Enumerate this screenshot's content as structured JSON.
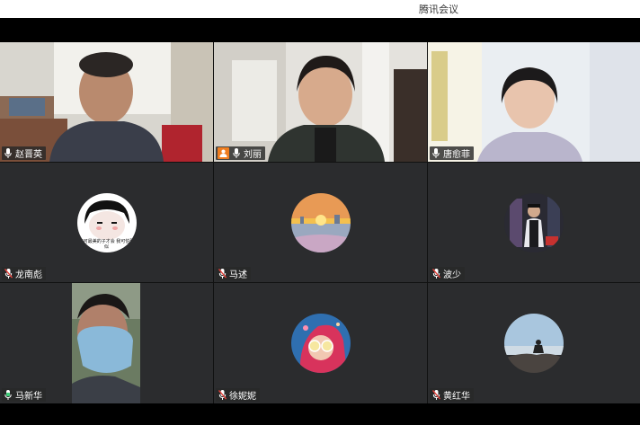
{
  "app": {
    "title": "腾讯会议"
  },
  "participants": [
    {
      "name": "赵晋英",
      "mic": "on",
      "video": true,
      "host": false
    },
    {
      "name": "刘丽",
      "mic": "on",
      "video": true,
      "host": true
    },
    {
      "name": "唐愈菲",
      "mic": "on",
      "video": true,
      "host": false
    },
    {
      "name": "龙南彪",
      "mic": "muted",
      "video": false,
      "avatar_caption": "俺可最美的子才会 我可怕那似"
    },
    {
      "name": "马述",
      "mic": "muted",
      "video": false
    },
    {
      "name": "波少",
      "mic": "muted",
      "video": false
    },
    {
      "name": "马新华",
      "mic": "speaking",
      "video": true,
      "active_speaker": true
    },
    {
      "name": "徐妮妮",
      "mic": "muted",
      "video": false
    },
    {
      "name": "黄红华",
      "mic": "muted",
      "video": false
    }
  ],
  "colors": {
    "active_border": "#18b35a",
    "host_badge": "#f07d1f",
    "muted_mic": "#e0413a",
    "speaking_mic": "#3fd07a"
  }
}
